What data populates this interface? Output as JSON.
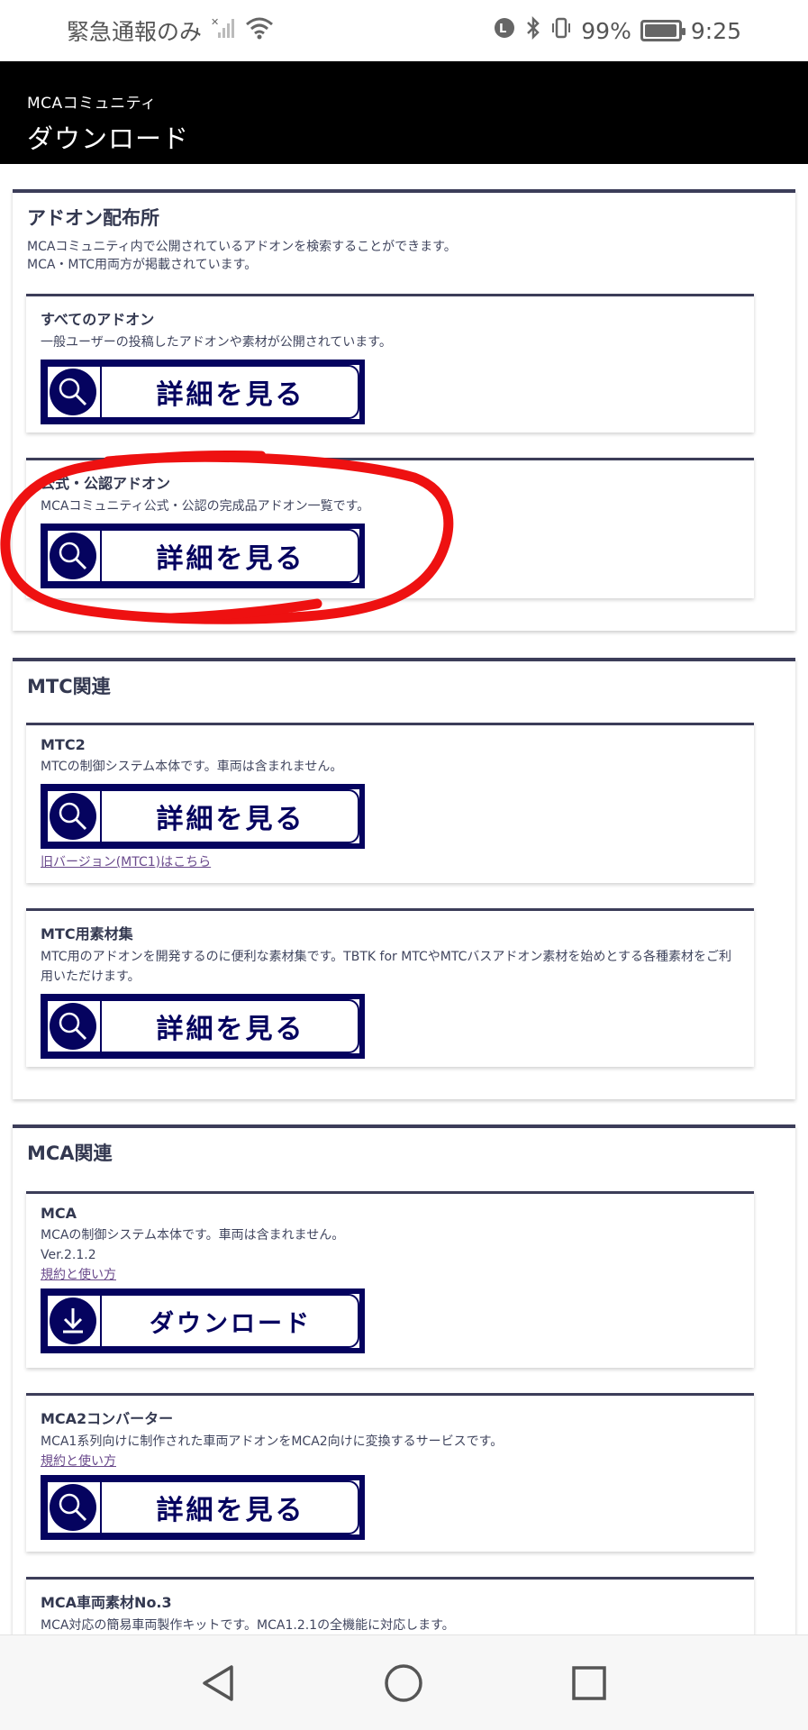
{
  "status_bar": {
    "carrier": "緊急通報のみ",
    "battery_percent": "99%",
    "time": "9:25",
    "battery_level": 0.99
  },
  "header": {
    "app_name": "MCAコミュニティ",
    "title": "ダウンロード"
  },
  "sections": [
    {
      "title": "アドオン配布所",
      "desc1": "MCAコミュニティ内で公開されているアドオンを検索することができます。",
      "desc2": "MCA・MTC用両方が掲載されています。",
      "cards": [
        {
          "title": "すべてのアドオン",
          "desc": "一般ユーザーの投稿したアドオンや素材が公開されています。",
          "button": "詳細を見る"
        },
        {
          "title": "公式・公認アドオン",
          "desc": "MCAコミュニティ公式・公認の完成品アドオン一覧です。",
          "button": "詳細を見る"
        }
      ]
    },
    {
      "title": "MTC関連",
      "cards": [
        {
          "title": "MTC2",
          "desc": "MTCの制御システム本体です。車両は含まれません。",
          "button": "詳細を見る",
          "link": "旧バージョン(MTC1)はこちら"
        },
        {
          "title": "MTC用素材集",
          "desc": "MTC用のアドオンを開発するのに便利な素材集です。TBTK for MTCやMTCバスアドオン素材を始めとする各種素材をご利用いただけます。",
          "button": "詳細を見る"
        }
      ]
    },
    {
      "title": "MCA関連",
      "cards": [
        {
          "title": "MCA",
          "desc": "MCAの制御システム本体です。車両は含まれません。",
          "version": "Ver.2.1.2",
          "link": "規約と使い方",
          "button": "ダウンロード"
        },
        {
          "title": "MCA2コンバーター",
          "desc": "MCA1系列向けに制作された車両アドオンをMCA2向けに変換するサービスです。",
          "link": "規約と使い方",
          "button": "詳細を見る"
        },
        {
          "title": "MCA車両素材No.3",
          "desc": "MCA対応の簡易車両製作キットです。MCA1.2.1の全機能に対応します。"
        }
      ]
    }
  ],
  "icons": {
    "search": "magnifier-icon",
    "download": "download-arrow-icon"
  },
  "colors": {
    "button_navy": "#05035f",
    "section_border": "#3c3d59",
    "annotation_red": "#ee1111"
  }
}
